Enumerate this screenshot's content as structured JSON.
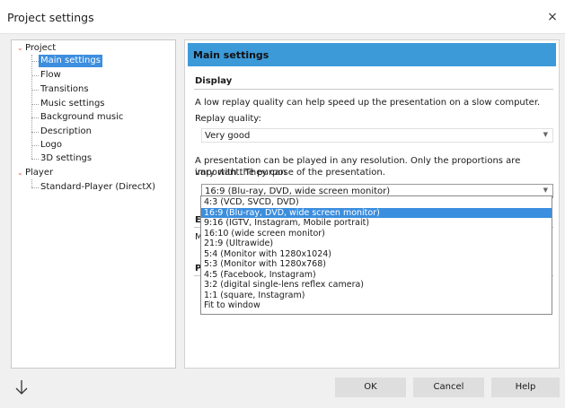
{
  "window": {
    "title": "Project settings",
    "close_symbol": "×"
  },
  "tree": {
    "project": "Project",
    "project_children": [
      "Main settings",
      "Flow",
      "Transitions",
      "Music settings",
      "Background music",
      "Description",
      "Logo",
      "3D settings"
    ],
    "selected_index": 0,
    "player": "Player",
    "player_children": [
      "Standard-Player (DirectX)"
    ]
  },
  "panel": {
    "header": "Main settings",
    "display_section": "Display",
    "quality_help": "A low replay quality can help speed up the presentation on a slow computer.",
    "quality_label": "Replay quality:",
    "quality_value": "Very good",
    "resolution_help_1": "A presentation can be played in any resolution. Only the proportions are important. They can",
    "resolution_help_2": "vary with the purpose of the presentation.",
    "aspect_value": "16:9 (Blu-ray, DVD, wide screen monitor)",
    "hidden_partial_section_1": "Effe",
    "hidden_partial_text": "Mot",
    "hidden_partial_section_2": "Play"
  },
  "aspect_options": [
    "4:3 (VCD, SVCD, DVD)",
    "16:9 (Blu-ray, DVD, wide screen monitor)",
    "9:16 (IGTV, Instagram, Mobile portrait)",
    "16:10 (wide screen monitor)",
    "21:9 (Ultrawide)",
    "5:4 (Monitor with 1280x1024)",
    "5:3 (Monitor with 1280x768)",
    "4:5 (Facebook, Instagram)",
    "3:2 (digital single-lens reflex camera)",
    "1:1 (square, Instagram)",
    "Fit to window"
  ],
  "aspect_selected_index": 1,
  "footer": {
    "ok": "OK",
    "cancel": "Cancel",
    "help": "Help"
  },
  "colors": {
    "accent": "#3c8ede",
    "header": "#3c9ad9",
    "tree_arrow": "#e8553f"
  }
}
